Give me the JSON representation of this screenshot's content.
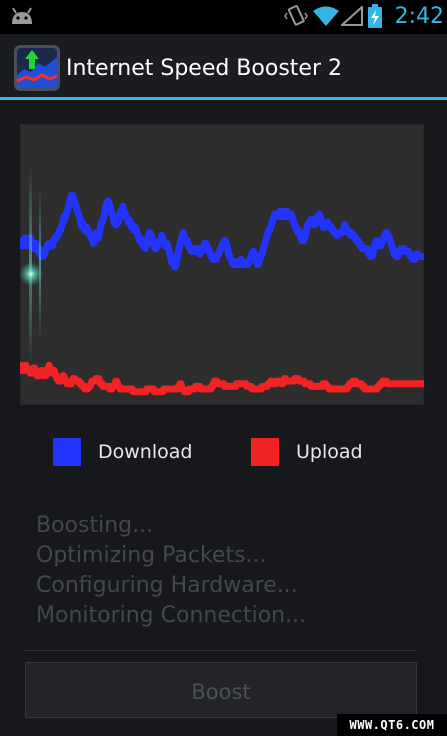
{
  "status_bar": {
    "time": "2:42",
    "icons": [
      "android-icon",
      "vibrate-icon",
      "wifi-icon",
      "signal-icon",
      "battery-charging-icon"
    ],
    "accent_color": "#33b5e5"
  },
  "app_bar": {
    "title": "Internet Speed Booster 2",
    "icon": "speed-booster-app-icon"
  },
  "chart_data": {
    "type": "line",
    "background": "#2d2d2d",
    "grid": false,
    "legend": "below",
    "ylim": [
      0,
      100
    ],
    "series": [
      {
        "name": "Download",
        "color": "#2434ff",
        "values": [
          59,
          59,
          57,
          58,
          59,
          59,
          60,
          58,
          57,
          58,
          59,
          60,
          60,
          60,
          58,
          58,
          57,
          56,
          57,
          58,
          57,
          56,
          55,
          56,
          54,
          55,
          53,
          54,
          53,
          55,
          54,
          56,
          56,
          57,
          57,
          58,
          57,
          58,
          58,
          57,
          58,
          59,
          60,
          60,
          60,
          61,
          61,
          62,
          63,
          63,
          64,
          65,
          66,
          68,
          67,
          68,
          69,
          70,
          71,
          72,
          73,
          75,
          76,
          76,
          76,
          75,
          73,
          73,
          72,
          71,
          70,
          69,
          68,
          67,
          65,
          66,
          64,
          65,
          63,
          64,
          63,
          64,
          62,
          63,
          62,
          61,
          60,
          60,
          59,
          58,
          60,
          61,
          62,
          61,
          60,
          60,
          62,
          63,
          65,
          66,
          66,
          67,
          68,
          70,
          72,
          73,
          73,
          74,
          73,
          72,
          71,
          70,
          69,
          68,
          66,
          66,
          65,
          65,
          66,
          66,
          67,
          69,
          70,
          69,
          71,
          72,
          70,
          70,
          68,
          68,
          67,
          66,
          67,
          66,
          65,
          64,
          65,
          64,
          63,
          64,
          64,
          63,
          62,
          61,
          60,
          59,
          60,
          59,
          58,
          57,
          58,
          57,
          56,
          57,
          58,
          60,
          61,
          62,
          62,
          61,
          60,
          59,
          58,
          57,
          56,
          56,
          57,
          57,
          58,
          59,
          59,
          60,
          61,
          60,
          59,
          58,
          57,
          58,
          58,
          57,
          56,
          55,
          54,
          52,
          51,
          51,
          50,
          50,
          49,
          50,
          51,
          53,
          55,
          56,
          58,
          59,
          60,
          61,
          62,
          61,
          60,
          59,
          58,
          59,
          58,
          57,
          56,
          56,
          55,
          56,
          56,
          55,
          55,
          55,
          55,
          56,
          56,
          55,
          54,
          55,
          56,
          55,
          56,
          57,
          58,
          58,
          57,
          57,
          56,
          55,
          55,
          54,
          53,
          53,
          52,
          52,
          52,
          52,
          52,
          53,
          54,
          54,
          55,
          56,
          56,
          57,
          58,
          58,
          59,
          59,
          58,
          57,
          56,
          54,
          53,
          53,
          52,
          51,
          51,
          50,
          50,
          50,
          51,
          50,
          51,
          50,
          50,
          51,
          52,
          51,
          51,
          50,
          51,
          50,
          50,
          50,
          50,
          51,
          51,
          52,
          53,
          54,
          54,
          55,
          54,
          53,
          52,
          51,
          50,
          50,
          51,
          52,
          53,
          54,
          54,
          56,
          57,
          58,
          59,
          60,
          61,
          62,
          63,
          63,
          64,
          65,
          66,
          67,
          68,
          69,
          68,
          69,
          68,
          68,
          69,
          70,
          70,
          69,
          68,
          68,
          69,
          70,
          70,
          70,
          70,
          69,
          68,
          68,
          69,
          69,
          68,
          67,
          66,
          65,
          64,
          64,
          63,
          62,
          63,
          62,
          61,
          60,
          59,
          59,
          59,
          60,
          61,
          62,
          64,
          65,
          65,
          66,
          66,
          67,
          67,
          66,
          65,
          65,
          65,
          66,
          67,
          68,
          68,
          69,
          68,
          67,
          66,
          65,
          64,
          64,
          65,
          65,
          66,
          66,
          65,
          64,
          64,
          64,
          64,
          63,
          63,
          62,
          62,
          62,
          61,
          61,
          62,
          62,
          62,
          62,
          62,
          62,
          63,
          64,
          65,
          64,
          63,
          63,
          63,
          62,
          62,
          61,
          61,
          62,
          61,
          61,
          60,
          60,
          59,
          59,
          59,
          58,
          58,
          57,
          57,
          56,
          56,
          56,
          56,
          56,
          56,
          56,
          55,
          54,
          54,
          53,
          53,
          53,
          54,
          56,
          57,
          58,
          59,
          59,
          58,
          58,
          57,
          57,
          58,
          58,
          59,
          60,
          61,
          61,
          62,
          62,
          61,
          61,
          60,
          59,
          58,
          57,
          56,
          55,
          54,
          54,
          53,
          53,
          53,
          54,
          54,
          55,
          56,
          56,
          56,
          56,
          56,
          55,
          55,
          55,
          55,
          55,
          54,
          54,
          53,
          53,
          52,
          52,
          52,
          52,
          53,
          54,
          54,
          53,
          53,
          53,
          53,
          53,
          53,
          53,
          53
        ]
      },
      {
        "name": "Upload",
        "color": "#f22324",
        "values": [
          12,
          11,
          10,
          10,
          10,
          11,
          12,
          12,
          11,
          10,
          10,
          10,
          9,
          9,
          9,
          10,
          11,
          11,
          10,
          9,
          8,
          8,
          8,
          9,
          9,
          10,
          10,
          9,
          8,
          8,
          8,
          9,
          10,
          11,
          12,
          11,
          10,
          9,
          9,
          9,
          10,
          9,
          8,
          7,
          7,
          6,
          6,
          6,
          6,
          7,
          8,
          8,
          7,
          6,
          6,
          5,
          5,
          5,
          5,
          5,
          5,
          6,
          7,
          7,
          7,
          6,
          6,
          6,
          6,
          6,
          5,
          5,
          5,
          4,
          4,
          4,
          3,
          3,
          3,
          3,
          4,
          4,
          4,
          5,
          6,
          6,
          6,
          6,
          6,
          7,
          7,
          7,
          7,
          6,
          5,
          5,
          5,
          4,
          4,
          4,
          4,
          4,
          4,
          4,
          4,
          3,
          3,
          3,
          4,
          4,
          4,
          5,
          6,
          6,
          5,
          4,
          4,
          3,
          3,
          3,
          3,
          3,
          3,
          3,
          3,
          3,
          3,
          3,
          3,
          3,
          3,
          3,
          2,
          2,
          2,
          2,
          2,
          2,
          2,
          2,
          2,
          2,
          2,
          2,
          2,
          2,
          2,
          2,
          3,
          3,
          3,
          3,
          3,
          3,
          3,
          3,
          3,
          2,
          2,
          2,
          2,
          2,
          2,
          2,
          2,
          2,
          2,
          2,
          3,
          3,
          3,
          3,
          3,
          3,
          3,
          3,
          3,
          3,
          3,
          3,
          3,
          3,
          3,
          3,
          3,
          4,
          4,
          5,
          5,
          4,
          3,
          3,
          2,
          2,
          2,
          2,
          2,
          2,
          3,
          3,
          3,
          3,
          3,
          3,
          3,
          4,
          4,
          4,
          4,
          4,
          4,
          3,
          3,
          3,
          3,
          3,
          3,
          3,
          3,
          3,
          3,
          3,
          3,
          3,
          4,
          4,
          5,
          6,
          6,
          6,
          6,
          5,
          5,
          5,
          5,
          5,
          5,
          5,
          5,
          4,
          4,
          4,
          4,
          4,
          4,
          4,
          4,
          4,
          4,
          4,
          4,
          4,
          4,
          5,
          5,
          5,
          5,
          5,
          5,
          5,
          5,
          5,
          5,
          5,
          5,
          4,
          4,
          4,
          4,
          4,
          4,
          3,
          3,
          3,
          3,
          3,
          3,
          3,
          3,
          3,
          3,
          3,
          3,
          4,
          4,
          4,
          4,
          4,
          4,
          4,
          5,
          5,
          5,
          6,
          6,
          5,
          5,
          5,
          5,
          5,
          6,
          6,
          6,
          6,
          6,
          6,
          5,
          5,
          6,
          7,
          7,
          6,
          6,
          6,
          6,
          6,
          6,
          6,
          6,
          6,
          6,
          7,
          7,
          7,
          7,
          7,
          6,
          6,
          6,
          6,
          6,
          6,
          6,
          5,
          5,
          5,
          5,
          5,
          5,
          5,
          4,
          4,
          4,
          4,
          4,
          4,
          4,
          4,
          4,
          4,
          4,
          4,
          4,
          4,
          5,
          5,
          5,
          5,
          4,
          4,
          4,
          3,
          3,
          3,
          3,
          3,
          3,
          3,
          3,
          3,
          3,
          3,
          3,
          3,
          3,
          3,
          3,
          3,
          3,
          3,
          3,
          3,
          3,
          4,
          4,
          5,
          5,
          5,
          5,
          6,
          6,
          6,
          6,
          5,
          5,
          5,
          5,
          5,
          5,
          5,
          4,
          4,
          4,
          3,
          3,
          3,
          3,
          3,
          3,
          3,
          3,
          3,
          3,
          3,
          3,
          3,
          3,
          3,
          4,
          4,
          4,
          5,
          5,
          5,
          6,
          6,
          6,
          6,
          6,
          5,
          5,
          5,
          5,
          5,
          5,
          5,
          5,
          5,
          5,
          5,
          5,
          5,
          5,
          5,
          5,
          5,
          5,
          5,
          5,
          5,
          5,
          5,
          5,
          5,
          5,
          5,
          5,
          5,
          5,
          5,
          5,
          5,
          5,
          5,
          5,
          5,
          5,
          5,
          5,
          5,
          5,
          5,
          5
        ]
      }
    ]
  },
  "legend": {
    "download_label": "Download",
    "download_color": "#2434ff",
    "upload_label": "Upload",
    "upload_color": "#f22324"
  },
  "status_lines": [
    "Boosting...",
    "Optimizing Packets...",
    "Configuring Hardware...",
    "Monitoring Connection..."
  ],
  "boost_button": {
    "label": "Boost"
  },
  "watermark": "WWW.QT6.COM"
}
